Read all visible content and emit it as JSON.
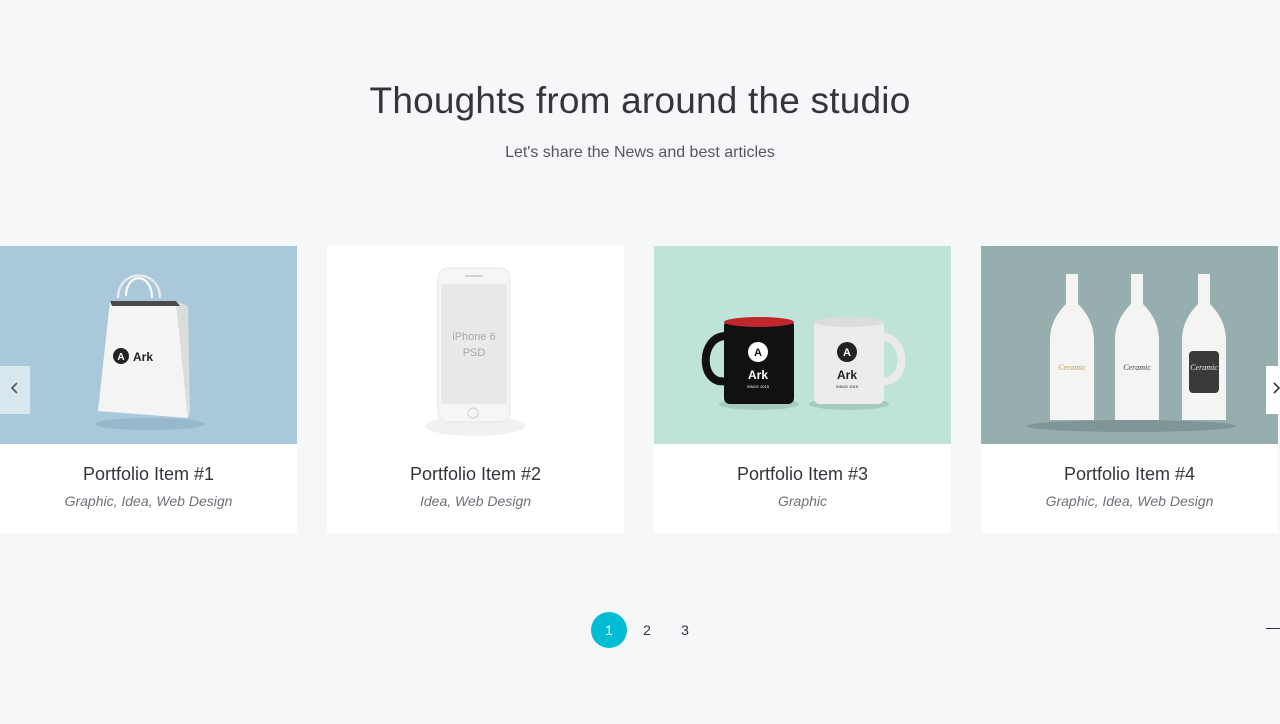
{
  "header": {
    "title": "Thoughts from around the studio",
    "subtitle": "Let's share the News and best articles"
  },
  "portfolio": {
    "items": [
      {
        "name": "Portfolio Item #1",
        "categories": "Graphic, Idea, Web Design",
        "image": "shopping-bag",
        "bg": "#a9c8da",
        "logo_text": "Ark"
      },
      {
        "name": "Portfolio Item #2",
        "categories": "Idea, Web Design",
        "image": "phone-mockup",
        "bg": "#ffffff",
        "screen_line1": "iPhone 6",
        "screen_line2": "PSD"
      },
      {
        "name": "Portfolio Item #3",
        "categories": "Graphic",
        "image": "mugs",
        "bg": "#bfe3d8",
        "logo_text": "Ark",
        "mug_tag": "SINCE 2015"
      },
      {
        "name": "Portfolio Item #4",
        "categories": "Graphic, Idea, Web Design",
        "image": "bottles",
        "bg": "#97aeaf",
        "label_text": "Ceramic"
      }
    ]
  },
  "carousel": {
    "prev_icon": "chevron-left-icon",
    "next_icon": "chevron-right-icon"
  },
  "pagination": {
    "pages": [
      "1",
      "2",
      "3"
    ],
    "active": "1",
    "accent": "#00bcd4"
  }
}
